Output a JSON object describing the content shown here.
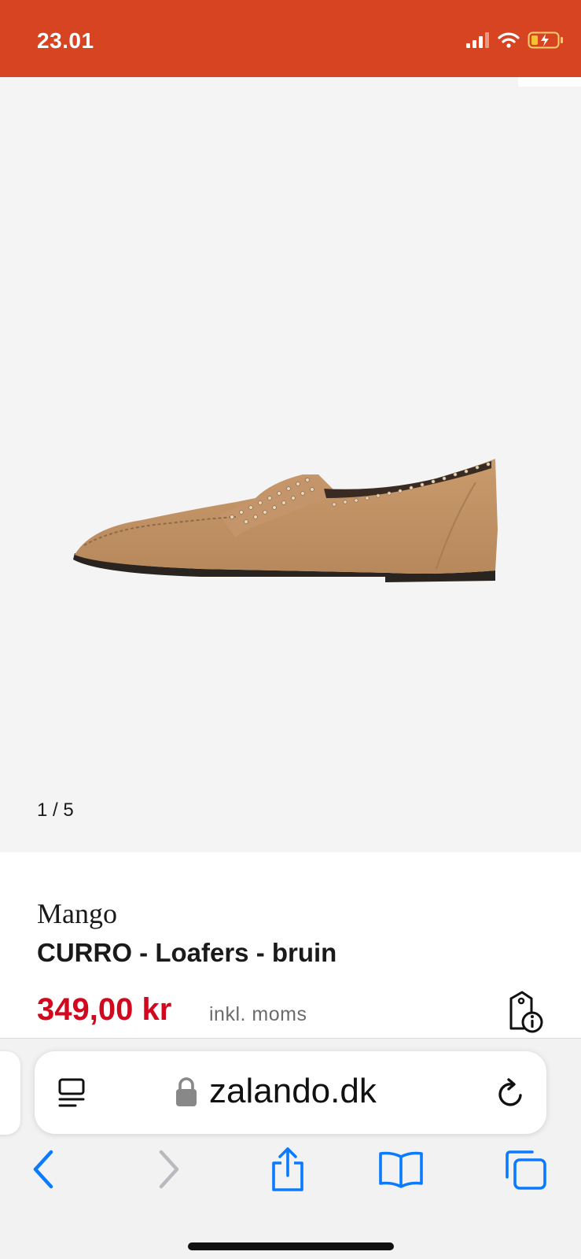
{
  "status_bar": {
    "time": "23.01",
    "background": "#d64422",
    "icons": [
      "cellular-signal-icon",
      "wifi-icon",
      "battery-charging-icon"
    ]
  },
  "gallery": {
    "pager": "1 / 5",
    "image": "tan-suede-studded-loafer"
  },
  "product": {
    "brand": "Mango",
    "name": "CURRO - Loafers - bruin",
    "price": "349,00 kr",
    "price_note": "inkl. moms",
    "price_color": "#d0091e",
    "price_info_icon": "price-tag-info-icon"
  },
  "browser": {
    "url": "zalando.dk",
    "left_icon": "reader-view-icon",
    "secure_icon": "lock-icon",
    "right_icon": "reload-icon",
    "toolbar": [
      "back-icon",
      "forward-icon",
      "share-icon",
      "bookmarks-icon",
      "tabs-icon"
    ],
    "accent": "#0a7aff"
  }
}
